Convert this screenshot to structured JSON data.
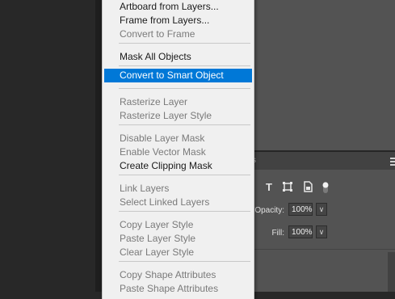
{
  "menu": {
    "items": [
      {
        "label": "Artboard from Layers...",
        "disabled": false
      },
      {
        "label": "Frame from Layers...",
        "disabled": false
      },
      {
        "label": "Convert to Frame",
        "disabled": true
      },
      {
        "label": "Mask All Objects",
        "disabled": false
      },
      {
        "label": "Convert to Smart Object",
        "disabled": false,
        "highlighted": true
      },
      {
        "label": "Rasterize Layer",
        "disabled": true
      },
      {
        "label": "Rasterize Layer Style",
        "disabled": true
      },
      {
        "label": "Disable Layer Mask",
        "disabled": true
      },
      {
        "label": "Enable Vector Mask",
        "disabled": true
      },
      {
        "label": "Create Clipping Mask",
        "disabled": false
      },
      {
        "label": "Link Layers",
        "disabled": true
      },
      {
        "label": "Select Linked Layers",
        "disabled": true
      },
      {
        "label": "Copy Layer Style",
        "disabled": true
      },
      {
        "label": "Paste Layer Style",
        "disabled": true
      },
      {
        "label": "Clear Layer Style",
        "disabled": true
      },
      {
        "label": "Copy Shape Attributes",
        "disabled": true
      },
      {
        "label": "Paste Shape Attributes",
        "disabled": true
      }
    ]
  },
  "layers_panel": {
    "tab_fragment": "s",
    "opacity_label": "Opacity:",
    "opacity_value": "100%",
    "fill_label": "Fill:",
    "fill_value": "100%",
    "dropdown_glyph": "∨",
    "icons": [
      "type-filter-icon",
      "shape-filter-icon",
      "smart-object-filter-icon",
      "toggle-filter-icon"
    ]
  },
  "colors": {
    "highlight": "#0078d7",
    "menu_bg": "#f0f0f0",
    "canvas_bg": "#535353",
    "app_bg": "#282828"
  }
}
